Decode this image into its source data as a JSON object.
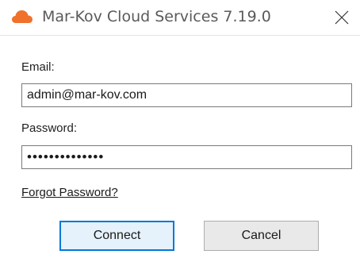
{
  "window": {
    "title": "Mar-Kov Cloud Services 7.19.0",
    "icon": "cloud-icon",
    "icon_color": "#f0712c",
    "close_icon": "close-icon"
  },
  "form": {
    "email_label": "Email:",
    "email_value": "admin@mar-kov.com",
    "password_label": "Password:",
    "password_value": "••••••••••••••",
    "forgot_link": "Forgot Password?"
  },
  "buttons": {
    "connect_label": "Connect",
    "cancel_label": "Cancel"
  },
  "colors": {
    "accent": "#0078d7",
    "brand": "#f0712c"
  }
}
